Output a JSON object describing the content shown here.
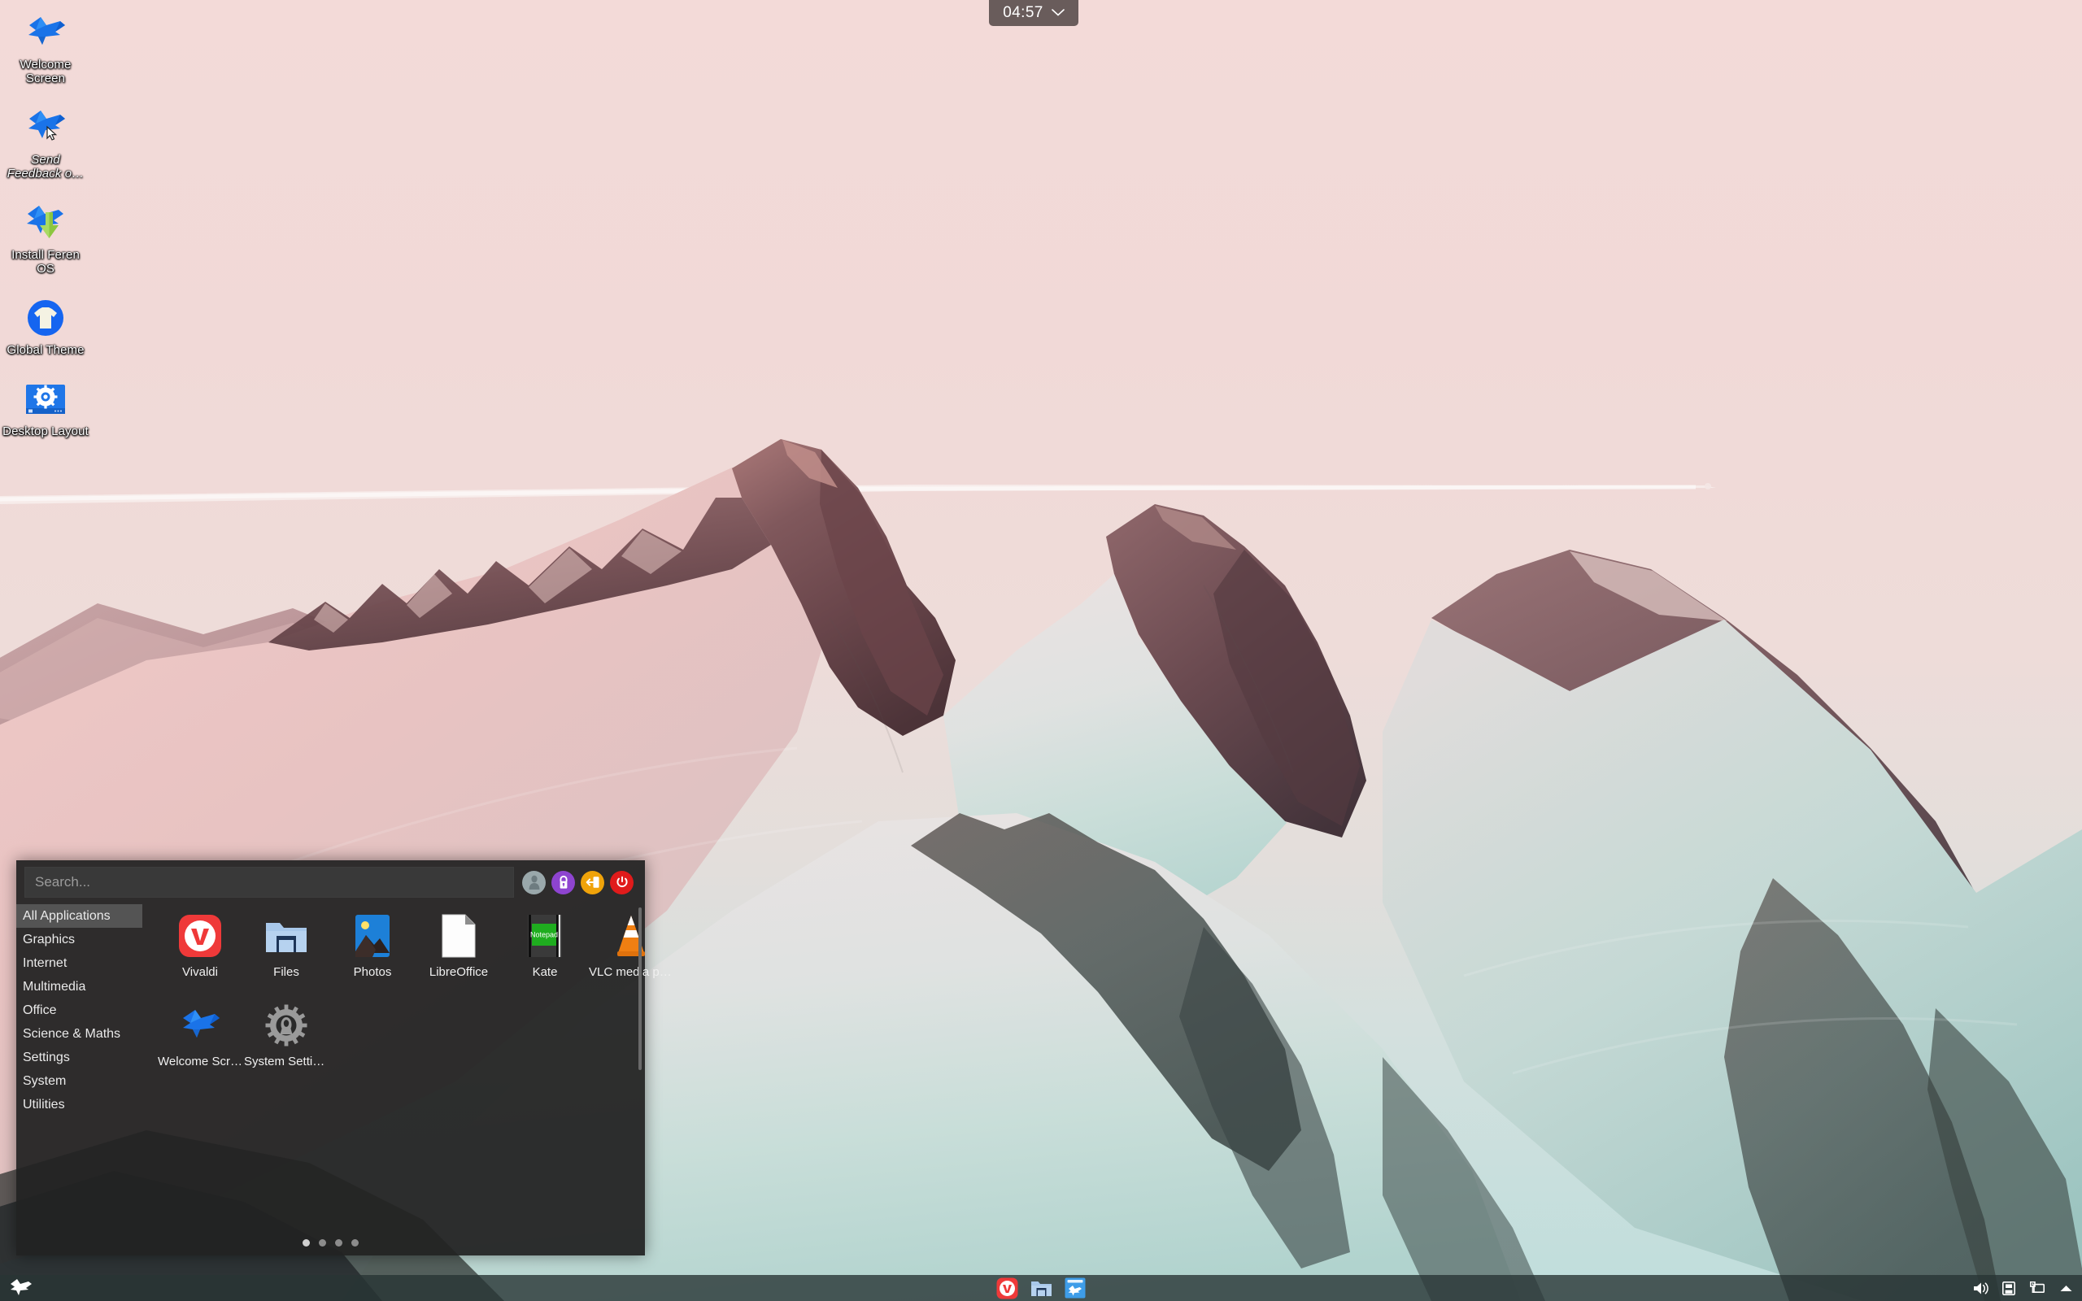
{
  "desktop": {
    "icons": [
      {
        "label": "Welcome Screen",
        "name": "welcome-screen",
        "icon": "feren-bird-icon",
        "italic": false
      },
      {
        "label": "Send Feedback o…",
        "name": "send-feedback",
        "icon": "feren-bird-cursor-icon",
        "italic": true
      },
      {
        "label": "Install Feren OS",
        "name": "install-feren-os",
        "icon": "feren-bird-download-icon",
        "italic": false
      },
      {
        "label": "Global Theme",
        "name": "global-theme",
        "icon": "tshirt-circle-icon",
        "italic": false
      },
      {
        "label": "Desktop Layout",
        "name": "desktop-layout",
        "icon": "gear-screen-icon",
        "italic": false
      }
    ]
  },
  "clock": {
    "time": "04:57",
    "chevron": "chevron-down-icon"
  },
  "menu": {
    "search": {
      "placeholder": "Search...",
      "value": ""
    },
    "session_buttons": [
      {
        "name": "user-avatar-button",
        "title": "User",
        "color": "#9aa8ab",
        "icon": "user-icon"
      },
      {
        "name": "lock-button",
        "title": "Lock",
        "color": "#8e44d0",
        "icon": "lock-icon"
      },
      {
        "name": "logout-button",
        "title": "Logout",
        "color": "#f0a30a",
        "icon": "logout-icon"
      },
      {
        "name": "power-button",
        "title": "Power",
        "color": "#e01b1b",
        "icon": "power-icon"
      }
    ],
    "categories": [
      {
        "label": "All Applications",
        "active": true
      },
      {
        "label": "Graphics",
        "active": false
      },
      {
        "label": "Internet",
        "active": false
      },
      {
        "label": "Multimedia",
        "active": false
      },
      {
        "label": "Office",
        "active": false
      },
      {
        "label": "Science & Maths",
        "active": false
      },
      {
        "label": "Settings",
        "active": false
      },
      {
        "label": "System",
        "active": false
      },
      {
        "label": "Utilities",
        "active": false
      }
    ],
    "apps": [
      {
        "label": "Vivaldi",
        "icon": "vivaldi-icon"
      },
      {
        "label": "Files",
        "icon": "folder-icon"
      },
      {
        "label": "Photos",
        "icon": "photos-icon"
      },
      {
        "label": "LibreOffice",
        "icon": "libreoffice-document-icon"
      },
      {
        "label": "Kate",
        "icon": "kate-notepad-icon",
        "badge": "Notepad"
      },
      {
        "label": "VLC media pl…",
        "icon": "vlc-cone-icon"
      },
      {
        "label": "Welcome Scr…",
        "icon": "feren-bird-icon"
      },
      {
        "label": "System Settin…",
        "icon": "gear-icon"
      }
    ],
    "pages": {
      "count": 4,
      "active_index": 0
    }
  },
  "taskbar": {
    "launcher": {
      "name": "feren-menu-launcher",
      "icon": "feren-bird-white-icon"
    },
    "pinned": [
      {
        "label": "Vivaldi",
        "icon": "vivaldi-icon"
      },
      {
        "label": "Files",
        "icon": "folder-icon"
      },
      {
        "label": "Welcome Screen",
        "icon": "feren-welcome-icon"
      }
    ],
    "tray": [
      {
        "name": "volume-icon",
        "icon": "speaker-icon"
      },
      {
        "name": "device-icon",
        "icon": "removable-device-icon"
      },
      {
        "name": "display-icon",
        "icon": "monitor-icon"
      },
      {
        "name": "show-hidden-icon",
        "icon": "chevron-up-icon"
      }
    ]
  },
  "theme": {
    "panel_bg": "#222222",
    "panel_text": "#f0f0f0",
    "highlight": "#585858",
    "taskbar_bg": "#283434",
    "sky_top": "#f2dcda",
    "sky_bottom": "#c9e2e0"
  }
}
